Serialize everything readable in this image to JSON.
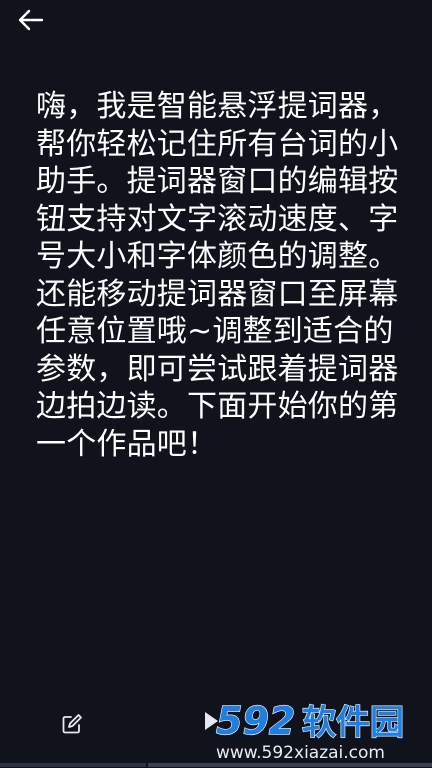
{
  "header": {
    "back_icon": "arrow-left-icon"
  },
  "script": {
    "text": "嗨，我是智能悬浮提词器，帮你轻松记住所有台词的小助手。提词器窗口的编辑按钮支持对文字滚动速度、字号大小和字体颜色的调整。还能移动提词器窗口至屏幕任意位置哦~调整到适合的参数，即可尝试跟着提词器边拍边读。下面开始你的第一个作品吧！"
  },
  "toolbar": {
    "edit_icon": "edit-icon",
    "play_icon": "play-icon"
  },
  "watermark": {
    "brand_number": "592",
    "brand_name": "软件园",
    "url": "www.592xiazai.com"
  },
  "colors": {
    "background": "#11131c",
    "text": "#ffffff",
    "watermark_blue": "#1e7fe0"
  }
}
